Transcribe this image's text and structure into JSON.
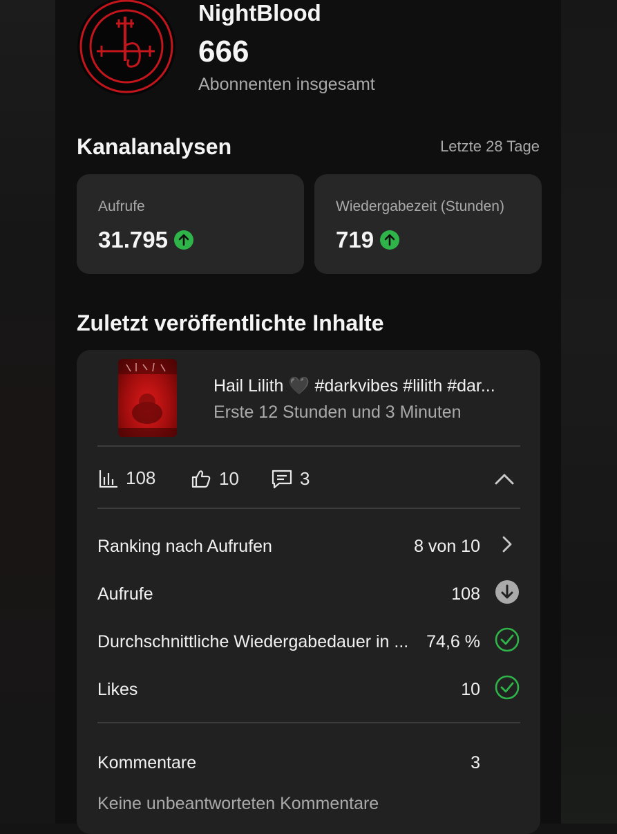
{
  "channel": {
    "name": "NightBlood",
    "subscriber_count": "666",
    "subscriber_label": "Abonnenten insgesamt"
  },
  "analytics": {
    "title": "Kanalanalysen",
    "period": "Letzte 28 Tage",
    "cards": [
      {
        "label": "Aufrufe",
        "value": "31.795",
        "trend_icon": "arrow-up-circle-icon"
      },
      {
        "label": "Wiedergabezeit (Stunden)",
        "value": "719",
        "trend_icon": "arrow-up-circle-icon"
      }
    ]
  },
  "recent": {
    "title": "Zuletzt veröffentlichte Inhalte",
    "video": {
      "title": "Hail Lilith 🖤 #darkvibes #lilith #dar...",
      "subtitle": "Erste 12 Stunden und 3 Minuten"
    },
    "quick_stats": {
      "views": "108",
      "likes": "10",
      "comments": "3"
    },
    "details": [
      {
        "label": "Ranking nach Aufrufen",
        "value": "8 von 10",
        "icon": "chevron-right-icon"
      },
      {
        "label": "Aufrufe",
        "value": "108",
        "icon": "arrow-down-circle-icon"
      },
      {
        "label": "Durchschnittliche Wiedergabedauer in ...",
        "value": "74,6 %",
        "icon": "check-circle-icon"
      },
      {
        "label": "Likes",
        "value": "10",
        "icon": "check-circle-icon"
      }
    ],
    "comments": {
      "label": "Kommentare",
      "value": "3",
      "note": "Keine unbeantworteten Kommentare"
    }
  },
  "colors": {
    "positive_green": "#2fb44a",
    "neutral_grey": "#aaaaaa",
    "card_bg": "#272727",
    "accent_red": "#c4151c"
  }
}
